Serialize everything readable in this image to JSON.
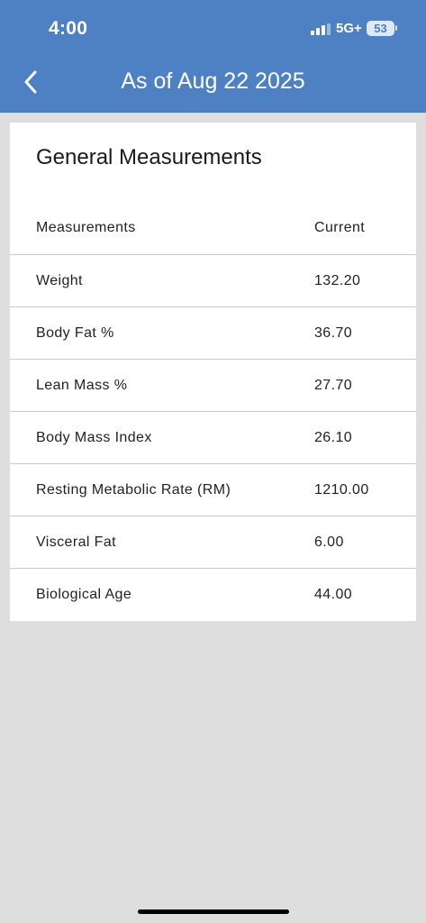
{
  "status_bar": {
    "time": "4:00",
    "network": "5G+",
    "battery": "53"
  },
  "nav": {
    "title": "As of Aug 22 2025",
    "back_icon": "chevron-left-icon"
  },
  "card": {
    "title": "General Measurements",
    "columns": [
      "Measurements",
      "Current"
    ],
    "rows": [
      {
        "name": "Weight",
        "value": "132.20"
      },
      {
        "name": "Body Fat %",
        "value": "36.70"
      },
      {
        "name": "Lean Mass %",
        "value": "27.70"
      },
      {
        "name": "Body Mass Index",
        "value": "26.10"
      },
      {
        "name": "Resting Metabolic Rate (RM)",
        "value": "1210.00"
      },
      {
        "name": "Visceral Fat",
        "value": "6.00"
      },
      {
        "name": "Biological Age",
        "value": "44.00"
      }
    ]
  },
  "colors": {
    "header": "#4e80c4",
    "background": "#dedede",
    "card": "#ffffff"
  }
}
